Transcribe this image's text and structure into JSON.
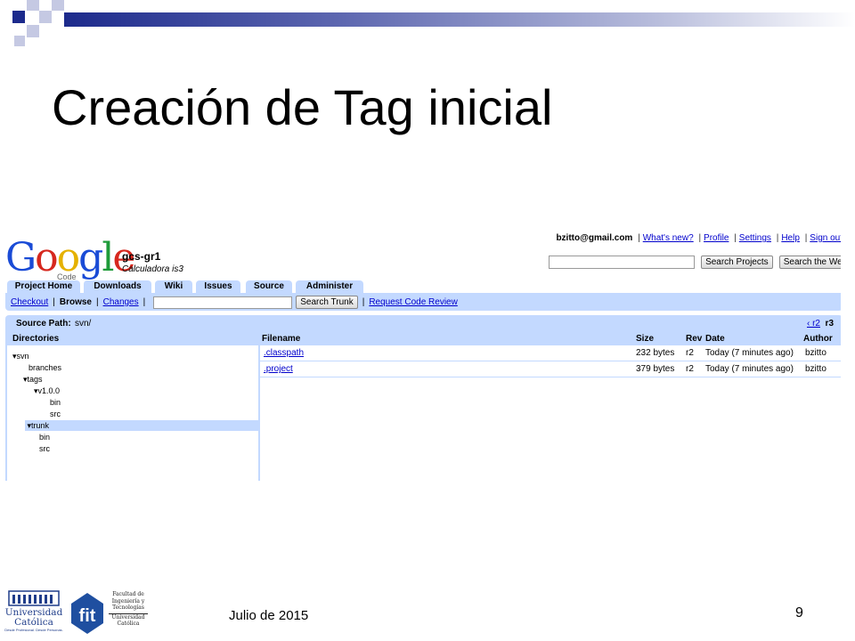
{
  "slide": {
    "title": "Creación de Tag inicial",
    "date": "Julio de 2015",
    "page_number": "9",
    "accent_color": "#1c2a8c"
  },
  "logos": {
    "left": {
      "name": "Universidad Católica",
      "text": "Universidad\nCatólica",
      "tagline": "Desde Profesional. Desde Personas."
    },
    "right": {
      "name": "fit",
      "lines": [
        "Facultad de",
        "Ingeniería y",
        "Tecnologías",
        "Universidad",
        "Católica"
      ]
    }
  },
  "browser": {
    "user_email": "bzitto@gmail.com",
    "user_links": [
      "What's new?",
      "Profile",
      "Settings",
      "Help",
      "Sign out"
    ],
    "logo_text": "Google",
    "logo_sub": "Code",
    "project_name": "gcs-gr1",
    "project_desc": "Calculadora is3",
    "search_projects_button": "Search Projects",
    "search_web_button": "Search the Web",
    "tabs": [
      "Project Home",
      "Downloads",
      "Wiki",
      "Issues",
      "Source",
      "Administer"
    ],
    "active_tab": "Source",
    "subnav": {
      "checkout": "Checkout",
      "browse": "Browse",
      "changes": "Changes",
      "search_trunk_button": "Search Trunk",
      "request_review": "Request Code Review"
    },
    "source_path_label": "Source Path:",
    "source_path_value": "svn/",
    "rev_prev": "‹ r2",
    "rev_current": "r3",
    "directories_header": "Directories",
    "tree": [
      {
        "label": "svn",
        "expanded": true
      },
      {
        "label": "branches"
      },
      {
        "label": "tags",
        "expanded": true
      },
      {
        "label": "v1.0.0",
        "expanded": true
      },
      {
        "label": "bin"
      },
      {
        "label": "src"
      },
      {
        "label": "trunk",
        "expanded": true,
        "selected": true
      },
      {
        "label": "bin"
      },
      {
        "label": "src"
      }
    ],
    "file_columns": [
      "Filename",
      "Size",
      "Rev",
      "Date",
      "Author"
    ],
    "files": [
      {
        "name": ".classpath",
        "size": "232 bytes",
        "rev": "r2",
        "date": "Today (7 minutes ago)",
        "author": "bzitto"
      },
      {
        "name": ".project",
        "size": "379 bytes",
        "rev": "r2",
        "date": "Today (7 minutes ago)",
        "author": "bzitto"
      }
    ]
  }
}
